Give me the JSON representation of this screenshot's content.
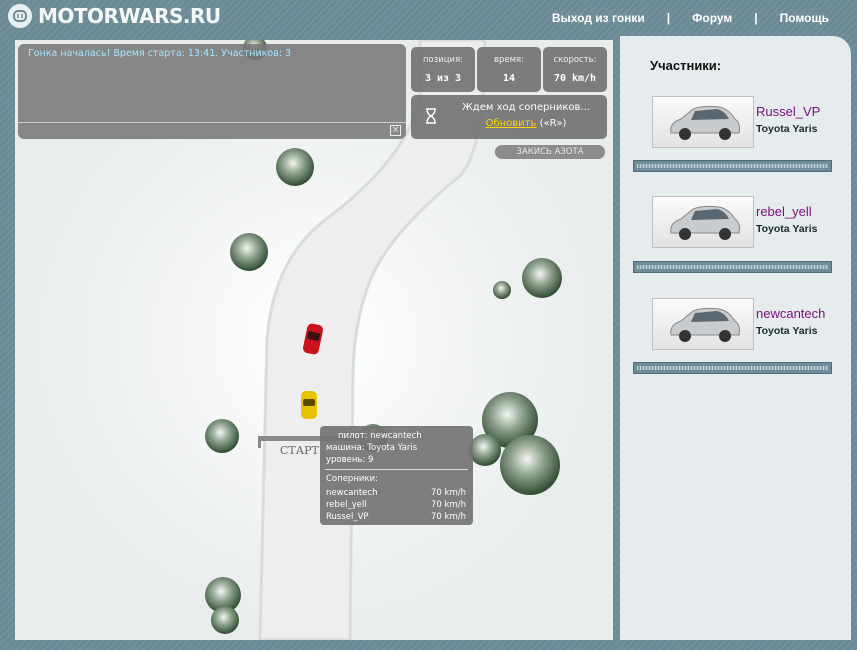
{
  "header": {
    "logo_text": "MOTORWARS.RU",
    "nav": [
      "Выход из гонки",
      "Форум",
      "Помощь"
    ],
    "separator": "|"
  },
  "message_panel": {
    "text": "Гонка началась! Время старта: 13:41. Участников: 3",
    "close_icon": "close-icon"
  },
  "stats": [
    {
      "label": "позиция:",
      "value": "3 из 3"
    },
    {
      "label": "время:",
      "value": "14"
    },
    {
      "label": "скорость:",
      "value": "70 km/h"
    }
  ],
  "wait_panel": {
    "icon": "hourglass-icon",
    "text": "Ждем ход соперников...",
    "refresh_link": "Обновить",
    "hotkey": "(«R»)"
  },
  "nitro_button": "ЗАКИСЬ АЗОТА",
  "track": {
    "start_label": "СТАРТ",
    "road_color": "#eeeeee",
    "cars": [
      {
        "color": "#c8141a",
        "name": "red-car"
      },
      {
        "color": "#e8c400",
        "name": "yellow-car"
      }
    ]
  },
  "info_tooltip": {
    "pilot": "пилот: newcantech",
    "car": "машина: Toyota Yaris",
    "level": "уровень: 9",
    "rivals_title": "Соперники:",
    "rivals": [
      {
        "name": "newcantech",
        "speed": "70 km/h"
      },
      {
        "name": "rebel_yell",
        "speed": "70 km/h"
      },
      {
        "name": "Russel_VP",
        "speed": "70 km/h"
      }
    ]
  },
  "sidebar": {
    "title": "Участники:",
    "players": [
      {
        "name": "Russel_VP",
        "car": "Toyota Yaris"
      },
      {
        "name": "rebel_yell",
        "car": "Toyota Yaris"
      },
      {
        "name": "newcantech",
        "car": "Toyota Yaris"
      }
    ]
  },
  "colors": {
    "frame": "#6b8a96",
    "sidebar": "#e6eced",
    "player_name": "#7a0f7a",
    "message_text": "#a8e6ff",
    "link": "#ffd400"
  }
}
